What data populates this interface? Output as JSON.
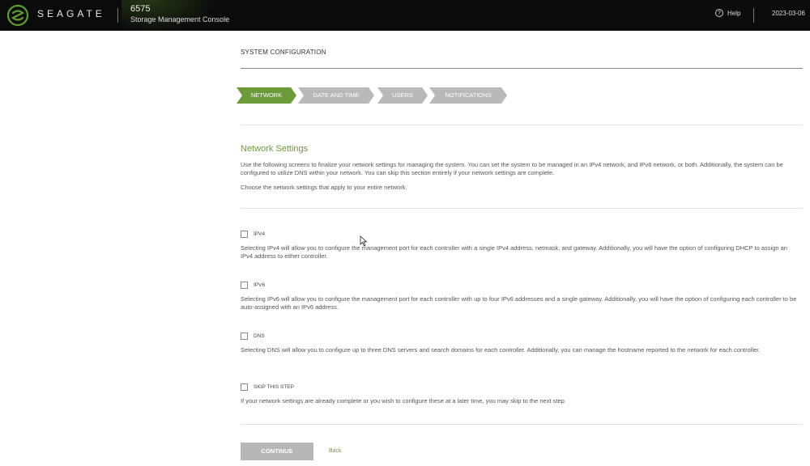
{
  "header": {
    "brand": "SEAGATE",
    "system_name": "6575",
    "console_name": "Storage Management Console",
    "help_label": "Help",
    "datetime": "2023-03-06"
  },
  "page": {
    "title": "SYSTEM CONFIGURATION"
  },
  "steps": [
    {
      "label": "NETWORK",
      "active": true
    },
    {
      "label": "DATE AND TIME",
      "active": false
    },
    {
      "label": "USERS",
      "active": false
    },
    {
      "label": "NOTIFICATIONS",
      "active": false
    }
  ],
  "network": {
    "heading": "Network Settings",
    "intro": "Use the following screens to finalize your network settings for managing the system. You can set the system to be managed in an IPv4 network, and IPv6 network, or both. Additionally, the system can be configured to utilize DNS within your network. You can skip this section entirely if your network settings are complete.",
    "instruction": "Choose the network settings that apply to your entire network.",
    "options": [
      {
        "label": "IPV4",
        "checked": false,
        "description": "Selecting IPv4 will allow you to configure the management port for each controller with a single IPv4 address, netmask, and gateway. Additionally, you will have the option of configuring DHCP to assign an IPv4 address to either controller."
      },
      {
        "label": "IPV6",
        "checked": false,
        "description": "Selecting IPv6 will allow you to configure the management port for each controller with up to four IPv6 addresses and a single gateway. Additionally, you will have the option of configuring each controller to be auto-assigned with an IPv6 address."
      },
      {
        "label": "DNS",
        "checked": false,
        "description": "Selecting DNS will allow you to configure up to three DNS servers and search domains for each controller. Additionally, you can manage the hostname reported to the network for each controller."
      },
      {
        "label": "SKIP THIS STEP",
        "checked": false,
        "description": "If your network settings are already complete or you wish to configure these at a later time, you may skip to the next step."
      }
    ]
  },
  "actions": {
    "continue_label": "CONTINUE",
    "back_label": "Back"
  },
  "colors": {
    "accent": "#6e9b3a",
    "header_bg": "#0b0b0b",
    "step_inactive": "#b9b9b9",
    "button_disabled": "#b7b7b7"
  }
}
